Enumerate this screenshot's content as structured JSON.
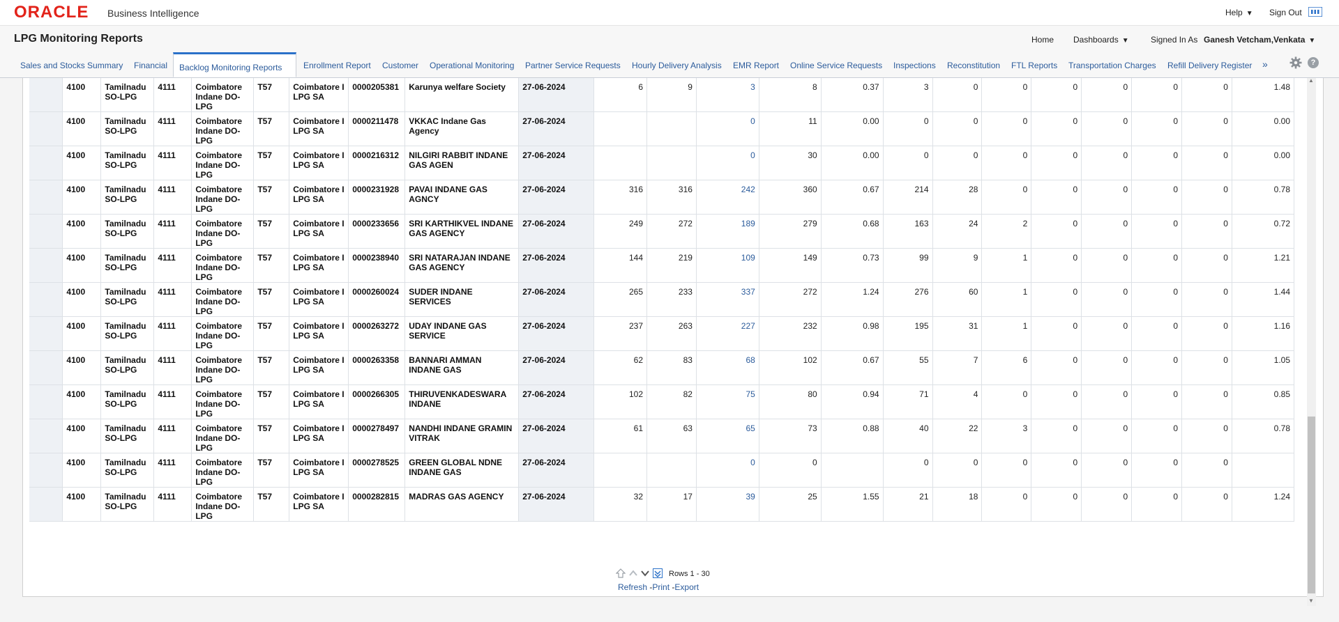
{
  "app": {
    "logo": "ORACLE",
    "product": "Business Intelligence",
    "help": "Help",
    "sign_out": "Sign Out"
  },
  "header": {
    "title": "LPG Monitoring Reports",
    "home": "Home",
    "dashboards": "Dashboards",
    "signed_in_label": "Signed In As",
    "user": "Ganesh Vetcham,Venkata"
  },
  "tabs": [
    {
      "label": "Sales and Stocks Summary"
    },
    {
      "label": "Financial"
    },
    {
      "label": "Backlog Monitoring Reports",
      "active": true
    },
    {
      "label": "Enrollment Report"
    },
    {
      "label": "Customer"
    },
    {
      "label": "Operational Monitoring"
    },
    {
      "label": "Partner Service Requests"
    },
    {
      "label": "Hourly Delivery Analysis"
    },
    {
      "label": "EMR Report"
    },
    {
      "label": "Online Service Requests"
    },
    {
      "label": "Inspections"
    },
    {
      "label": "Reconstitution"
    },
    {
      "label": "FTL Reports"
    },
    {
      "label": "Transportation Charges"
    },
    {
      "label": "Refill Delivery Register"
    }
  ],
  "tab_more": "»",
  "icons": {
    "gear": "gear-icon",
    "help": "help-icon",
    "grid": "grid-icon"
  },
  "colors": {
    "oracle_red": "#e2231a",
    "link_blue": "#2b5b9b",
    "active_tab": "#2b71c9"
  },
  "table": {
    "rows": [
      [
        "4100",
        "Tamilnadu SO-LPG",
        "4111",
        "Coimbatore Indane DO-LPG",
        "T57",
        "Coimbatore I LPG SA",
        "0000205381",
        "Karunya welfare Society",
        "27-06-2024",
        "6",
        "9",
        "3",
        "8",
        "0.37",
        "3",
        "0",
        "0",
        "0",
        "0",
        "0",
        "0",
        "1.48"
      ],
      [
        "4100",
        "Tamilnadu SO-LPG",
        "4111",
        "Coimbatore Indane DO-LPG",
        "T57",
        "Coimbatore I LPG SA",
        "0000211478",
        "VKKAC Indane Gas Agency",
        "27-06-2024",
        "",
        "",
        "0",
        "11",
        "0.00",
        "0",
        "0",
        "0",
        "0",
        "0",
        "0",
        "0",
        "0.00"
      ],
      [
        "4100",
        "Tamilnadu SO-LPG",
        "4111",
        "Coimbatore Indane DO-LPG",
        "T57",
        "Coimbatore I LPG SA",
        "0000216312",
        "NILGIRI RABBIT INDANE GAS AGEN",
        "27-06-2024",
        "",
        "",
        "0",
        "30",
        "0.00",
        "0",
        "0",
        "0",
        "0",
        "0",
        "0",
        "0",
        "0.00"
      ],
      [
        "4100",
        "Tamilnadu SO-LPG",
        "4111",
        "Coimbatore Indane DO-LPG",
        "T57",
        "Coimbatore I LPG SA",
        "0000231928",
        "PAVAI INDANE GAS AGNCY",
        "27-06-2024",
        "316",
        "316",
        "242",
        "360",
        "0.67",
        "214",
        "28",
        "0",
        "0",
        "0",
        "0",
        "0",
        "0.78"
      ],
      [
        "4100",
        "Tamilnadu SO-LPG",
        "4111",
        "Coimbatore Indane DO-LPG",
        "T57",
        "Coimbatore I LPG SA",
        "0000233656",
        "SRI KARTHIKVEL INDANE GAS AGENCY",
        "27-06-2024",
        "249",
        "272",
        "189",
        "279",
        "0.68",
        "163",
        "24",
        "2",
        "0",
        "0",
        "0",
        "0",
        "0.72"
      ],
      [
        "4100",
        "Tamilnadu SO-LPG",
        "4111",
        "Coimbatore Indane DO-LPG",
        "T57",
        "Coimbatore I LPG SA",
        "0000238940",
        "SRI NATARAJAN INDANE GAS AGENCY",
        "27-06-2024",
        "144",
        "219",
        "109",
        "149",
        "0.73",
        "99",
        "9",
        "1",
        "0",
        "0",
        "0",
        "0",
        "1.21"
      ],
      [
        "4100",
        "Tamilnadu SO-LPG",
        "4111",
        "Coimbatore Indane DO-LPG",
        "T57",
        "Coimbatore I LPG SA",
        "0000260024",
        "SUDER INDANE SERVICES",
        "27-06-2024",
        "265",
        "233",
        "337",
        "272",
        "1.24",
        "276",
        "60",
        "1",
        "0",
        "0",
        "0",
        "0",
        "1.44"
      ],
      [
        "4100",
        "Tamilnadu SO-LPG",
        "4111",
        "Coimbatore Indane DO-LPG",
        "T57",
        "Coimbatore I LPG SA",
        "0000263272",
        "UDAY INDANE GAS SERVICE",
        "27-06-2024",
        "237",
        "263",
        "227",
        "232",
        "0.98",
        "195",
        "31",
        "1",
        "0",
        "0",
        "0",
        "0",
        "1.16"
      ],
      [
        "4100",
        "Tamilnadu SO-LPG",
        "4111",
        "Coimbatore Indane DO-LPG",
        "T57",
        "Coimbatore I LPG SA",
        "0000263358",
        "BANNARI AMMAN INDANE GAS",
        "27-06-2024",
        "62",
        "83",
        "68",
        "102",
        "0.67",
        "55",
        "7",
        "6",
        "0",
        "0",
        "0",
        "0",
        "1.05"
      ],
      [
        "4100",
        "Tamilnadu SO-LPG",
        "4111",
        "Coimbatore Indane DO-LPG",
        "T57",
        "Coimbatore I LPG SA",
        "0000266305",
        "THIRUVENKADESWARA INDANE",
        "27-06-2024",
        "102",
        "82",
        "75",
        "80",
        "0.94",
        "71",
        "4",
        "0",
        "0",
        "0",
        "0",
        "0",
        "0.85"
      ],
      [
        "4100",
        "Tamilnadu SO-LPG",
        "4111",
        "Coimbatore Indane DO-LPG",
        "T57",
        "Coimbatore I LPG SA",
        "0000278497",
        "NANDHI INDANE GRAMIN VITRAK",
        "27-06-2024",
        "61",
        "63",
        "65",
        "73",
        "0.88",
        "40",
        "22",
        "3",
        "0",
        "0",
        "0",
        "0",
        "0.78"
      ],
      [
        "4100",
        "Tamilnadu SO-LPG",
        "4111",
        "Coimbatore Indane DO-LPG",
        "T57",
        "Coimbatore I LPG SA",
        "0000278525",
        "GREEN GLOBAL NDNE INDANE GAS",
        "27-06-2024",
        "",
        "",
        "0",
        "0",
        "",
        "0",
        "0",
        "0",
        "0",
        "0",
        "0",
        "0",
        ""
      ],
      [
        "4100",
        "Tamilnadu SO-LPG",
        "4111",
        "Coimbatore Indane DO-LPG",
        "T57",
        "Coimbatore I LPG SA",
        "0000282815",
        "MADRAS GAS AGENCY",
        "27-06-2024",
        "32",
        "17",
        "39",
        "25",
        "1.55",
        "21",
        "18",
        "0",
        "0",
        "0",
        "0",
        "0",
        "1.24"
      ]
    ]
  },
  "pager": {
    "rows_label": "Rows 1 - 30",
    "refresh": "Refresh",
    "print": "Print",
    "export": "Export",
    "sep": "-"
  }
}
